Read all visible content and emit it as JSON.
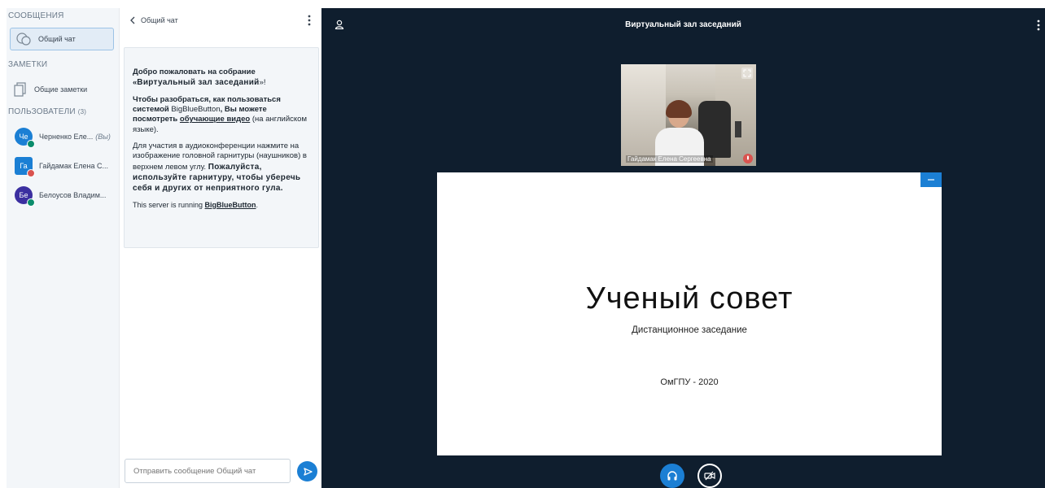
{
  "sidebar": {
    "messages_title": "СООБЩЕНИЯ",
    "public_chat_label": "Общий чат",
    "notes_title": "ЗАМЕТКИ",
    "shared_notes_label": "Общие заметки",
    "users_title": "ПОЛЬЗОВАТЕЛИ",
    "users_count": "(3)",
    "users": [
      {
        "initials": "Че",
        "name": "Черненко Еле...",
        "you": "(Вы)",
        "color": "#1b7fd4",
        "status_color": "#0a8c6c"
      },
      {
        "initials": "Га",
        "name": "Гайдамак Елена С...",
        "color": "#1b7fd4",
        "status_color": "#d9534f"
      },
      {
        "initials": "Бе",
        "name": "Белоусов Владим...",
        "color": "#3b2fa0",
        "status_color": "#0a8c6c"
      }
    ]
  },
  "chat": {
    "header": "Общий чат",
    "welcome": {
      "p1_a": "Добро пожаловать на собрание «",
      "p1_b": "Виртуальный зал заседаний",
      "p1_c": "»!",
      "p2_a": "Чтобы разобраться, как пользоваться системой ",
      "p2_b": "BigBlueButton",
      "p2_c": ", Вы можете посмотреть ",
      "p2_link": "обучающие видео",
      "p2_d": " (на английском языке).",
      "p3_a": "Для участия в аудиоконференции нажмите на изображение головной гарнитуры (наушников) в верхнем левом углу. ",
      "p3_b": "Пожалуйста, используйте гарнитуру, чтобы уберечь себя и других от неприятного гула.",
      "p4_a": "This server is running ",
      "p4_link": "BigBlueButton",
      "p4_c": "."
    },
    "input_placeholder": "Отправить сообщение Общий чат"
  },
  "main": {
    "title": "Виртуальный зал заседаний",
    "webcam_name": "Гайдамак Елена Сергеевна",
    "slide": {
      "title": "Ученый совет",
      "subtitle": "Дистанционное заседание",
      "organization": "ОмГПУ - 2020"
    }
  },
  "icons": {
    "chat": "chat-bubble-icon",
    "notes": "document-icon",
    "user": "user-icon",
    "menu": "kebab-menu-icon",
    "send": "send-icon",
    "audio": "headphones-icon",
    "video": "video-off-icon",
    "expand": "fullscreen-icon",
    "minimize": "minimize-icon"
  },
  "colors": {
    "accent": "#1b7fd4",
    "main_bg": "#0f1e2e",
    "sidebar_bg": "#f3f6f9"
  }
}
